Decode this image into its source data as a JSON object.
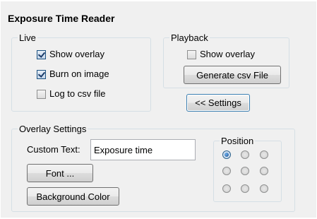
{
  "title": "Exposure Time Reader",
  "live": {
    "legend": "Live",
    "show_overlay": {
      "label": "Show overlay",
      "checked": true
    },
    "burn_on_image": {
      "label": "Burn on image",
      "checked": true
    },
    "log_to_csv": {
      "label": "Log to csv file",
      "checked": false
    }
  },
  "playback": {
    "legend": "Playback",
    "show_overlay": {
      "label": "Show overlay",
      "checked": false
    },
    "generate_csv_label": "Generate csv File"
  },
  "settings_toggle_label": "<< Settings",
  "overlay_settings": {
    "legend": "Overlay Settings",
    "custom_text_label": "Custom Text:",
    "custom_text_value": "Exposure time",
    "font_button_label": "Font ...",
    "background_color_button_label": "Background Color",
    "position": {
      "legend": "Position",
      "selected_index": 0,
      "grid": "3x3"
    }
  }
}
